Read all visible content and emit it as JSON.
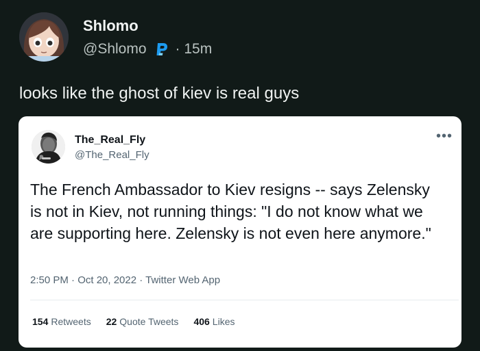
{
  "post": {
    "author": {
      "name": "Shlomo",
      "handle": "@Shlomo",
      "time": "· 15m",
      "avatar_icon": "anime-girl-avatar-icon",
      "platform_icon": "paypal-p-icon"
    },
    "text": "looks like the ghost of kiev is real guys"
  },
  "embedded_tweet": {
    "author": {
      "name": "The_Real_Fly",
      "handle": "@The_Real_Fly",
      "avatar_icon": "man-portrait-avatar-icon"
    },
    "text": "The French Ambassador to Kiev resigns --  says Zelensky is not in Kiev, not running things: \"I do not know what we are supporting here. Zelensky is not even here anymore.\"",
    "timestamp": "2:50 PM · Oct 20, 2022 · Twitter Web App",
    "more_icon": "more-options-icon",
    "stats": [
      {
        "count": "154",
        "label": "Retweets"
      },
      {
        "count": "22",
        "label": "Quote Tweets"
      },
      {
        "count": "406",
        "label": "Likes"
      }
    ]
  },
  "colors": {
    "background": "#111a18",
    "platform_icon": "#1d9bf0",
    "embed_card": "#ffffff"
  }
}
